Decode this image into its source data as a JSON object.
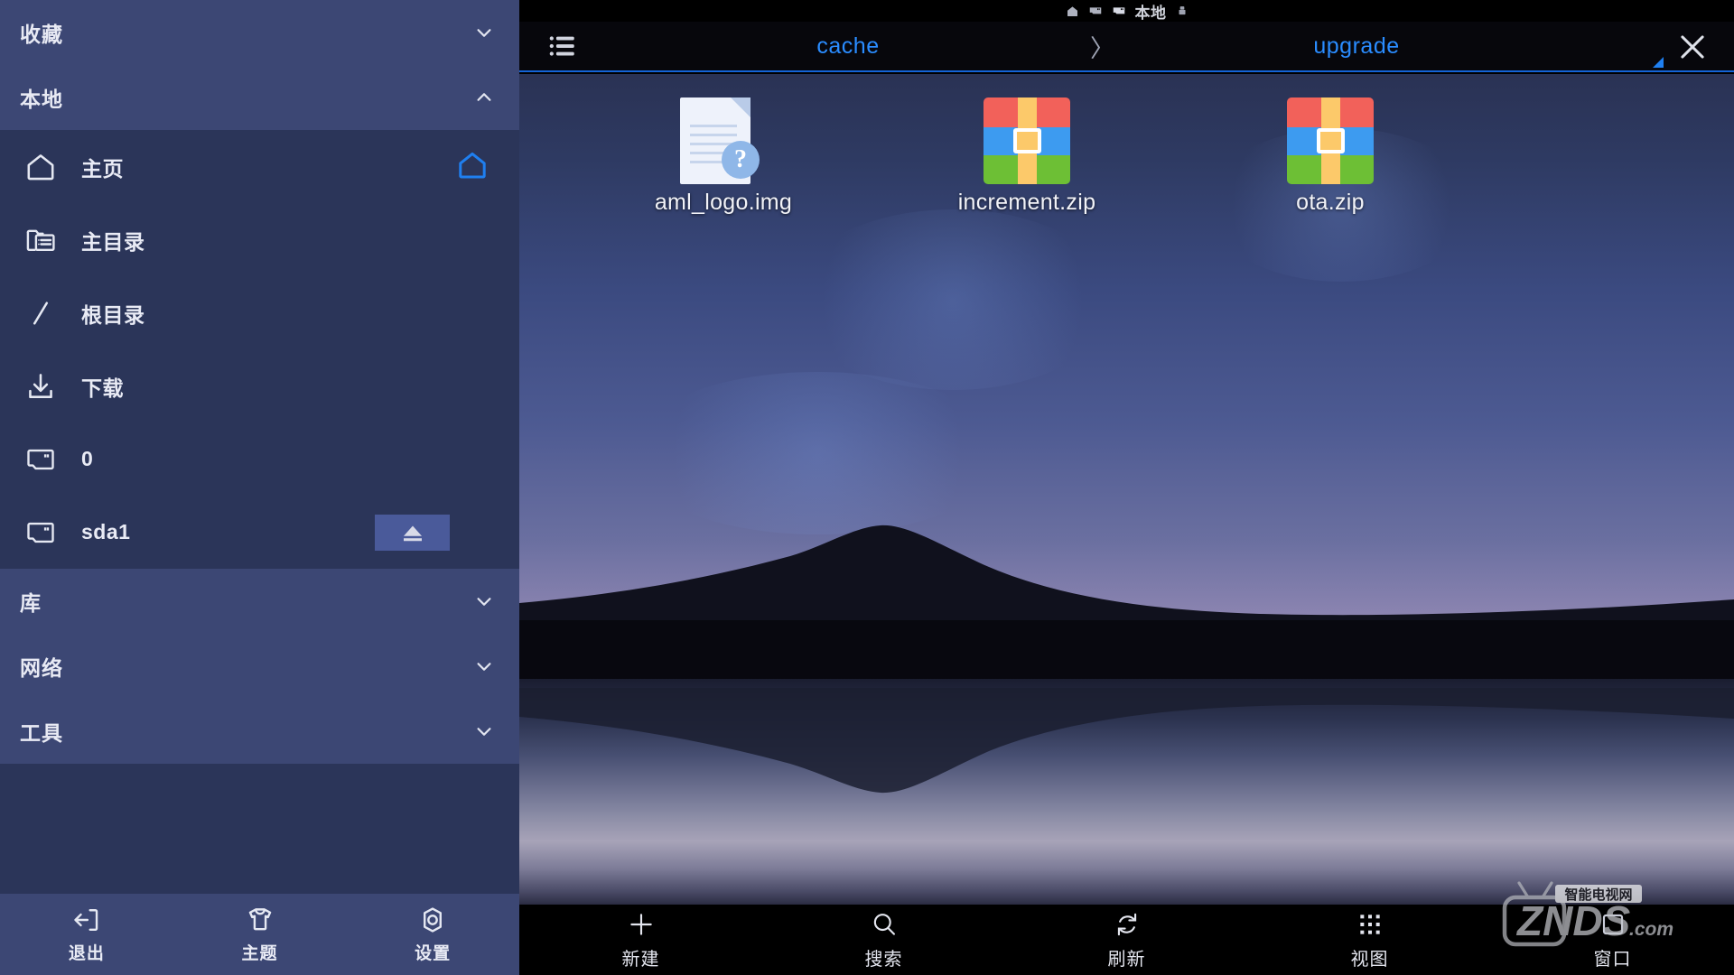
{
  "sidebar": {
    "sections": [
      {
        "id": "favorites",
        "label": "收藏",
        "expanded": false,
        "chevron": "chevron-down-icon"
      },
      {
        "id": "local",
        "label": "本地",
        "expanded": true,
        "chevron": "chevron-up-icon"
      }
    ],
    "local_items": [
      {
        "id": "home",
        "label": "主页",
        "icon": "home-icon",
        "right_icon": "home-accent-icon"
      },
      {
        "id": "homedir",
        "label": "主目录",
        "icon": "folder-list-icon"
      },
      {
        "id": "root",
        "label": "根目录",
        "icon": "slash-icon"
      },
      {
        "id": "downloads",
        "label": "下载",
        "icon": "download-icon"
      },
      {
        "id": "storage0",
        "label": "0",
        "icon": "sdcard-icon"
      },
      {
        "id": "sda1",
        "label": "sda1",
        "icon": "sdcard-icon",
        "eject": true,
        "eject_icon": "eject-icon"
      }
    ],
    "collapsed_sections": [
      {
        "id": "library",
        "label": "库",
        "chevron": "chevron-down-icon"
      },
      {
        "id": "network",
        "label": "网络",
        "chevron": "chevron-down-icon"
      },
      {
        "id": "tools",
        "label": "工具",
        "chevron": "chevron-down-icon"
      }
    ],
    "footer": [
      {
        "id": "exit",
        "label": "退出",
        "icon": "exit-icon"
      },
      {
        "id": "theme",
        "label": "主题",
        "icon": "tshirt-icon"
      },
      {
        "id": "settings",
        "label": "设置",
        "icon": "gear-icon"
      }
    ]
  },
  "statusbar": {
    "label": "本地",
    "icons": [
      "home-icon",
      "sdcard-icon",
      "sdcard-icon",
      "usb-icon"
    ]
  },
  "breadcrumb": {
    "menu_icon": "list-menu-icon",
    "crumbs": [
      {
        "label": "cache"
      },
      {
        "label": "upgrade"
      }
    ],
    "separator": "〉",
    "close_icon": "close-icon",
    "resize_icon": "resize-handle-icon",
    "accent_color": "#2a8cff",
    "underline_color": "#1464d8"
  },
  "files": [
    {
      "name": "aml_logo.img",
      "type": "document-unknown",
      "icon": "document-question-icon"
    },
    {
      "name": "increment.zip",
      "type": "archive",
      "icon": "zip-archive-icon"
    },
    {
      "name": "ota.zip",
      "type": "archive",
      "icon": "zip-archive-icon"
    }
  ],
  "bottombar": [
    {
      "id": "new",
      "label": "新建",
      "icon": "plus-icon"
    },
    {
      "id": "search",
      "label": "搜索",
      "icon": "search-icon"
    },
    {
      "id": "refresh",
      "label": "刷新",
      "icon": "refresh-icon"
    },
    {
      "id": "view",
      "label": "视图",
      "icon": "grid-view-icon"
    },
    {
      "id": "window",
      "label": "窗口",
      "icon": "window-icon"
    }
  ],
  "watermark": {
    "top_text": "智能电视网",
    "brand": "ZNDS",
    "suffix": ".com"
  }
}
